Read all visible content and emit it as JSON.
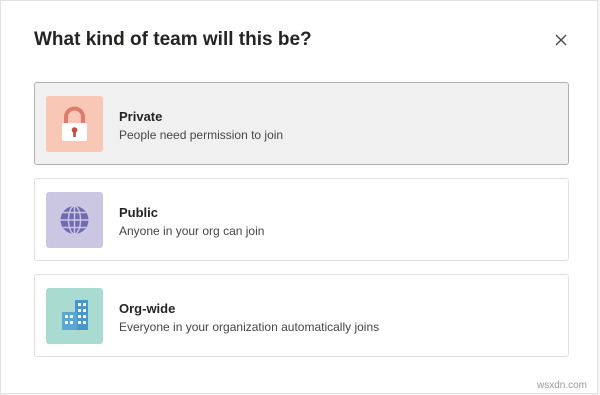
{
  "dialog": {
    "title": "What kind of team will this be?",
    "close_icon": "close-icon"
  },
  "options": [
    {
      "id": "private",
      "title": "Private",
      "description": "People need permission to join",
      "icon": "lock-icon",
      "tile_color": "#f8c7b6",
      "icon_color": "#e07a6a",
      "selected": true
    },
    {
      "id": "public",
      "title": "Public",
      "description": "Anyone in your org can join",
      "icon": "globe-icon",
      "tile_color": "#cbc7e3",
      "icon_color": "#6f6cb1",
      "selected": false
    },
    {
      "id": "org-wide",
      "title": "Org-wide",
      "description": "Everyone in your organization automatically joins",
      "icon": "building-icon",
      "tile_color": "#a9dbd1",
      "icon_color": "#4a95c9",
      "selected": false
    }
  ],
  "watermark": "wsxdn.com"
}
